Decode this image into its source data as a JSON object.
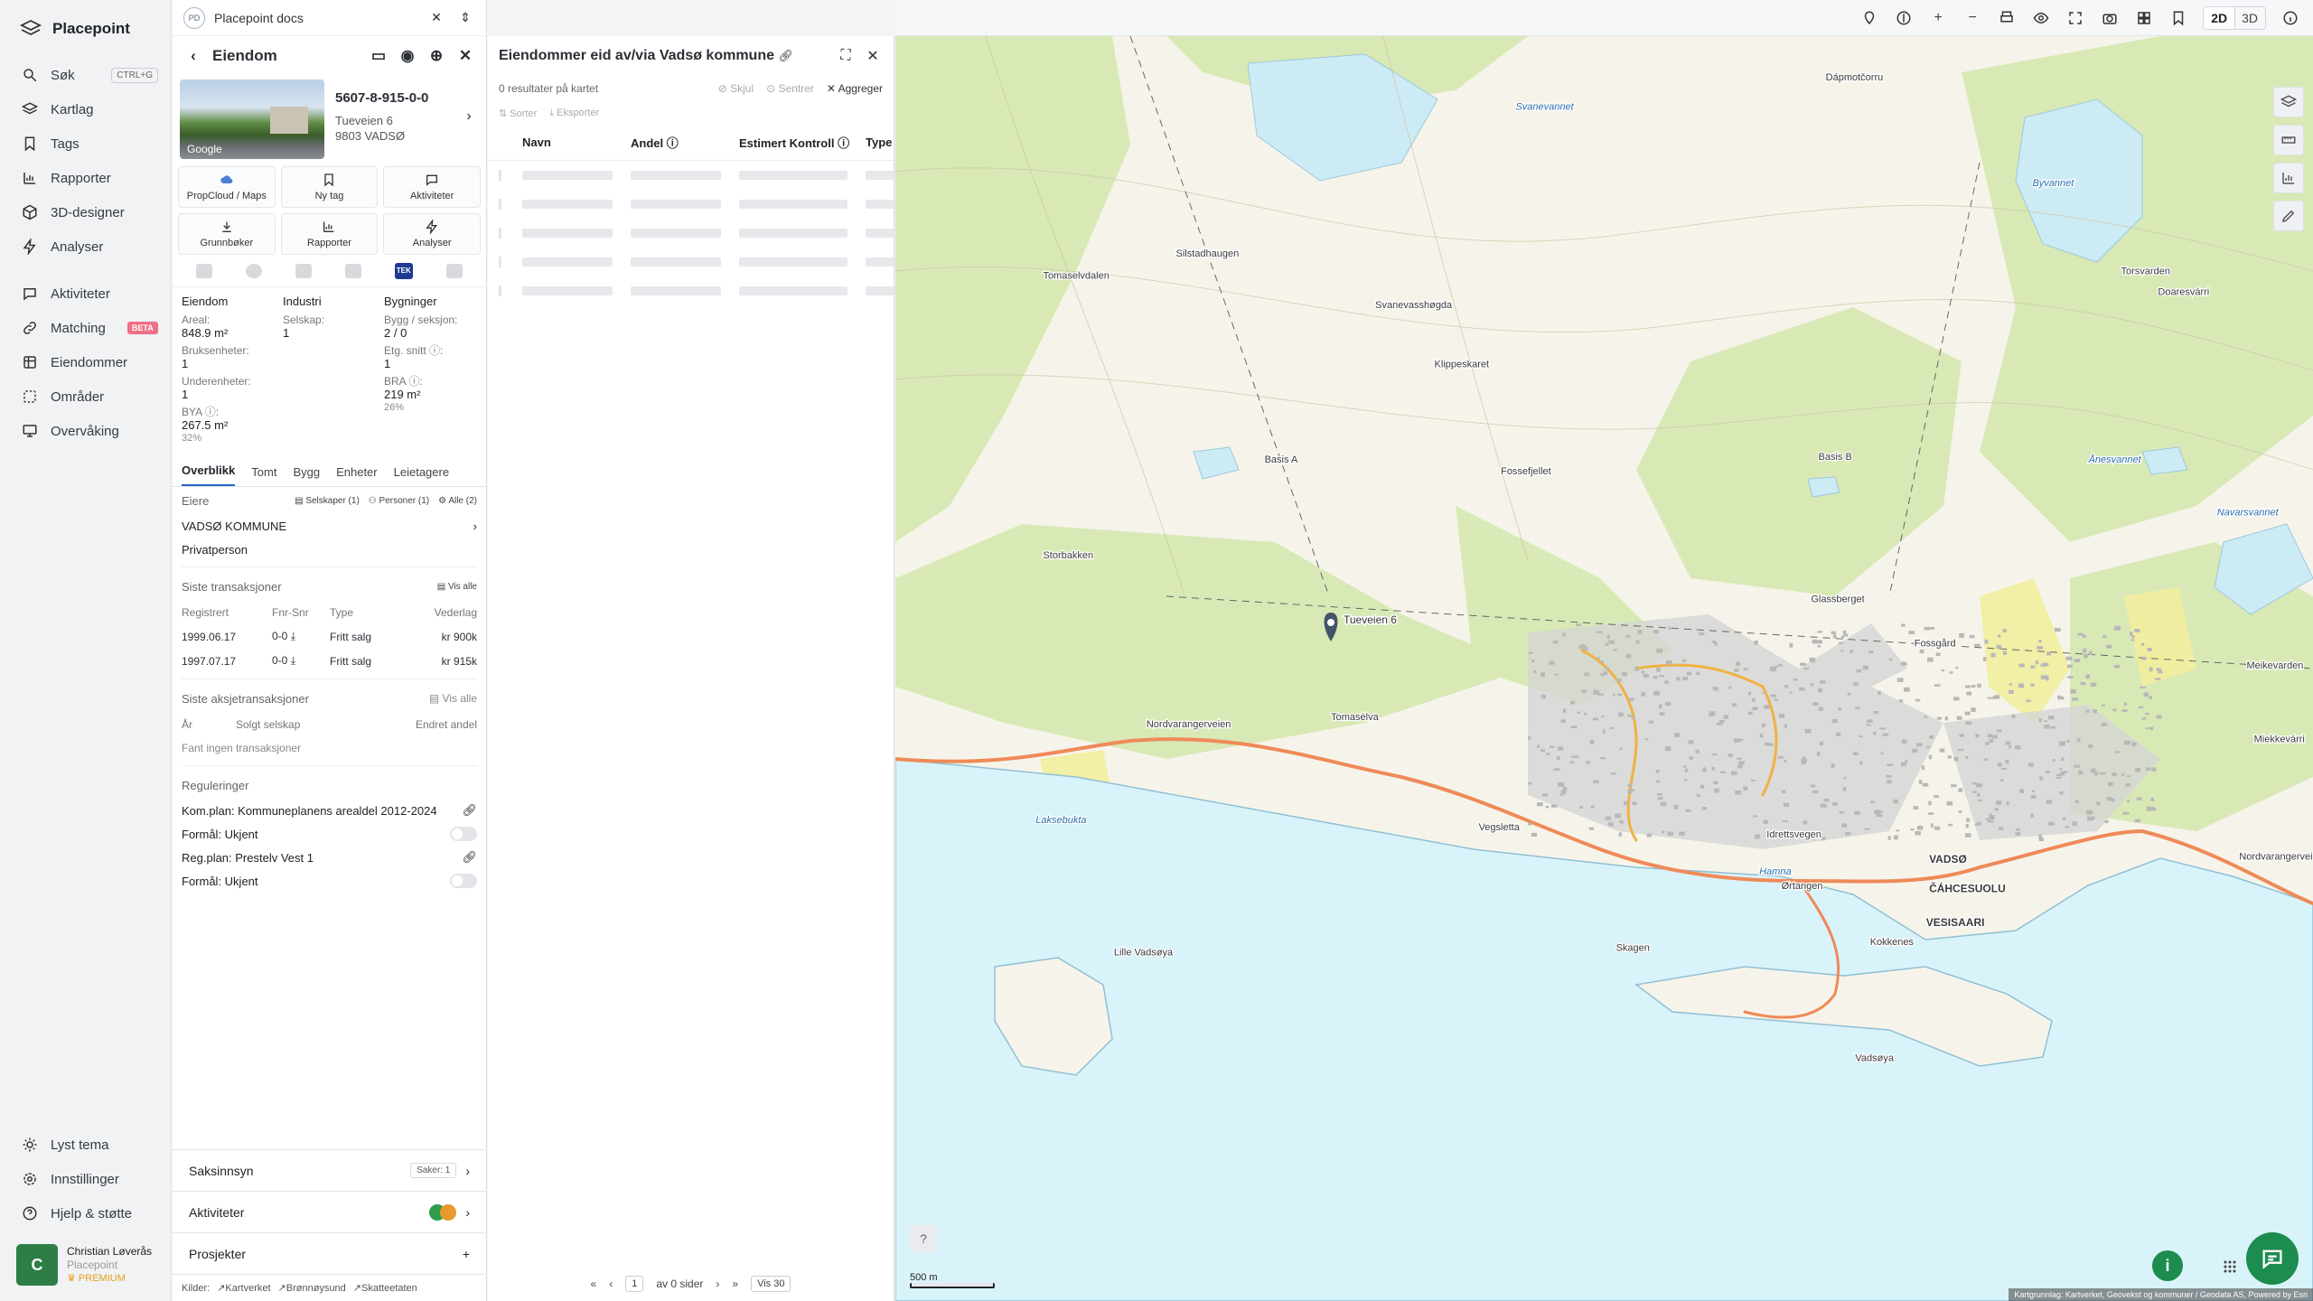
{
  "app": {
    "title": "Placepoint",
    "doc_title": "Placepoint docs",
    "doc_badge": "PD"
  },
  "nav": {
    "items": [
      {
        "label": "Søk",
        "shortcut": "CTRL+G"
      },
      {
        "label": "Kartlag"
      },
      {
        "label": "Tags"
      },
      {
        "label": "Rapporter"
      },
      {
        "label": "3D-designer"
      },
      {
        "label": "Analyser"
      },
      {
        "label": "Aktiviteter"
      },
      {
        "label": "Matching",
        "badge": "BETA"
      },
      {
        "label": "Eiendommer"
      },
      {
        "label": "Områder"
      },
      {
        "label": "Overvåking"
      }
    ],
    "bottom": [
      {
        "label": "Lyst tema"
      },
      {
        "label": "Innstillinger"
      },
      {
        "label": "Hjelp & støtte"
      }
    ],
    "user": {
      "initial": "C",
      "name": "Christian Løverås",
      "org": "Placepoint",
      "plan": "PREMIUM"
    }
  },
  "property": {
    "header": "Eiendom",
    "id": "5607-8-915-0-0",
    "street": "Tueveien 6",
    "postal": "9803 VADSØ",
    "photo_credit": "Google",
    "actions": [
      "PropCloud / Maps",
      "Ny tag",
      "Aktiviteter",
      "Grunnbøker",
      "Rapporter",
      "Analyser"
    ],
    "tek_label": "TEK",
    "facts": {
      "c1": {
        "head": "Eiendom",
        "areal_k": "Areal:",
        "areal_v": "848.9 m²",
        "bruks_k": "Bruksenheter:",
        "bruks_v": "1",
        "under_k": "Underenheter:",
        "under_v": "1",
        "bya_k": "BYA ⓘ:",
        "bya_v": "267.5 m²",
        "bya_s": "32%"
      },
      "c2": {
        "head": "Industri",
        "selskap_k": "Selskap:",
        "selskap_v": "1"
      },
      "c3": {
        "head": "Bygninger",
        "bygg_k": "Bygg / seksjon:",
        "bygg_v": "2 / 0",
        "etg_k": "Etg. snitt ⓘ:",
        "etg_v": "1",
        "bra_k": "BRA ⓘ:",
        "bra_v": "219 m²",
        "bra_s": "26%"
      }
    },
    "tabs": [
      "Overblikk",
      "Tomt",
      "Bygg",
      "Enheter",
      "Leietagere"
    ],
    "owners": {
      "title": "Eiere",
      "chips": [
        "Selskaper (1)",
        "Personer (1)",
        "Alle (2)"
      ],
      "name": "VADSØ KOMMUNE",
      "type": "Privatperson"
    },
    "transactions": {
      "title": "Siste transaksjoner",
      "show_all": "Vis alle",
      "columns": [
        "Registrert",
        "Fnr-Snr",
        "Type",
        "Vederlag"
      ],
      "rows": [
        [
          "1999.06.17",
          "0-0",
          "Fritt salg",
          "kr 900k"
        ],
        [
          "1997.07.17",
          "0-0",
          "Fritt salg",
          "kr 915k"
        ]
      ]
    },
    "stock": {
      "title": "Siste aksjetransaksjoner",
      "show_all": "Vis alle",
      "columns": [
        "År",
        "Solgt selskap",
        "Endret andel"
      ],
      "empty": "Fant ingen transaksjoner"
    },
    "regs": {
      "title": "Reguleringer",
      "rows": [
        "Kom.plan: Kommuneplanens arealdel 2012-2024",
        "Formål: Ukjent",
        "Reg.plan: Prestelv Vest 1",
        "Formål: Ukjent"
      ]
    },
    "accordions": {
      "saksinnsyn": "Saksinnsyn",
      "saker": "Saker: 1",
      "aktiviteter": "Aktiviteter",
      "prosjekter": "Prosjekter"
    },
    "sources": {
      "label": "Kilder:",
      "items": [
        "Kartverket",
        "Brønnøysund",
        "Skatteetaten"
      ]
    }
  },
  "list": {
    "title": "Eiendommer eid av/via Vadsø kommune",
    "results": "0 resultater på kartet",
    "buttons": [
      "Skjul",
      "Sentrer",
      "Aggreger"
    ],
    "tools": [
      "Sorter",
      "Eksporter"
    ],
    "columns": [
      "Navn",
      "Andel ⓘ",
      "Estimert Kontroll ⓘ",
      "Type"
    ],
    "pager": {
      "page": "1",
      "of": "av 0 sider",
      "per": "Vis 30"
    }
  },
  "map": {
    "mode_2d": "2D",
    "mode_3d": "3D",
    "scale": "500 m",
    "attribution": "Kartgrunnlag: Kartverket, Geovekst og kommuner / Geodata AS, Powered by Esri",
    "marker_label": "Tueveien 6",
    "places": [
      {
        "t": "Dápmotčorru"
      },
      {
        "t": "Svanevannet"
      },
      {
        "t": "Silstadhaugen"
      },
      {
        "t": "Svanevasshøgda"
      },
      {
        "t": "Klippeskaret"
      },
      {
        "t": "Basis A"
      },
      {
        "t": "Fossefjellet"
      },
      {
        "t": "Basis B"
      },
      {
        "t": "Storbakken"
      },
      {
        "t": "Glassberget"
      },
      {
        "t": "Fossgård"
      },
      {
        "t": "Tomasėlva"
      },
      {
        "t": "Nordvarangerveien"
      },
      {
        "t": "Idrettsvegen"
      },
      {
        "t": "Laksebukta"
      },
      {
        "t": "Vegsletta"
      },
      {
        "t": "VADSØ"
      },
      {
        "t": "ČÁHCESUOLU"
      },
      {
        "t": "VESISAARI"
      },
      {
        "t": "Hamna"
      },
      {
        "t": "Ørtangen"
      },
      {
        "t": "Skagen"
      },
      {
        "t": "Lille Vadsøya"
      },
      {
        "t": "Kokkenes"
      },
      {
        "t": "Vadsøya"
      },
      {
        "t": "Torsvarden"
      },
      {
        "t": "Doaresvárri"
      },
      {
        "t": "Byvannet"
      },
      {
        "t": "Navarsvannet"
      },
      {
        "t": "Meikevarden"
      },
      {
        "t": "Miekkevárri"
      },
      {
        "t": "Nordvarangerveien"
      },
      {
        "t": "Ånesvannet"
      },
      {
        "t": "Tomaselvdalen"
      }
    ],
    "colors": {
      "water": "#d9f3fa",
      "land": "#f6f4ea",
      "forest": "#d8e9b6",
      "road": "#ef8a58",
      "marker": "#44546a",
      "accent": "#1d8c4f"
    }
  }
}
